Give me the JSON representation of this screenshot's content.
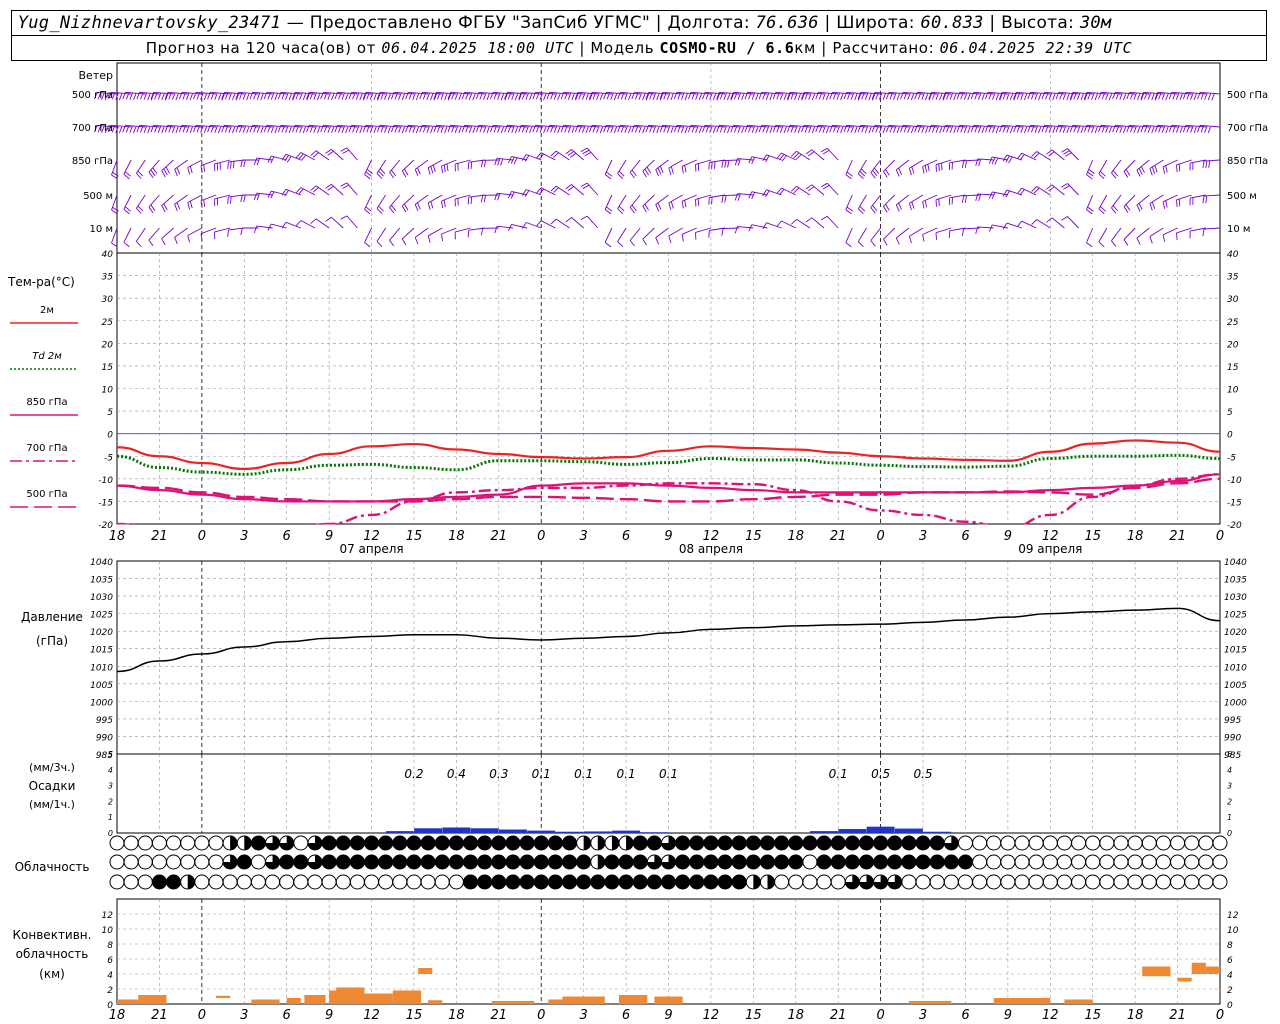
{
  "header": {
    "station": "Yug_Nizhnevartovsky_23471",
    "provider": " — Предоставлено ФГБУ \"ЗапСиб УГМС\" | Долгота: ",
    "lon": "76.636",
    "lat_label": " | Широта: ",
    "lat": "60.833",
    "alt_label": " | Высота: ",
    "alt": "30м",
    "fc_label": "Прогноз на 120 часа(ов) от ",
    "fc_time": "06.04.2025 18:00 UTC",
    "model_label": "  | Модель ",
    "model": "COSMO-RU / 6.6",
    "model_unit": "км",
    "calc_label": " | Рассчитано: ",
    "calc_time": "06.04.2025 22:39 UTC"
  },
  "wind_panel": {
    "title": "Ветер",
    "levels": [
      "500 гПа",
      "700 гПа",
      "850 гПа",
      "500 м",
      "10 м"
    ],
    "color": "#7700cc"
  },
  "temp_panel": {
    "title": "Тем-ра(°С)",
    "legend": [
      {
        "label": "2м",
        "color": "#ee2222",
        "dash": "solid"
      },
      {
        "label": "Td 2м",
        "color": "#007700",
        "dash": "dotted"
      },
      {
        "label": "850 гПа",
        "color": "#dd1177",
        "dash": "solid"
      },
      {
        "label": "700 гПа",
        "color": "#dd1177",
        "dash": "dashdot"
      },
      {
        "label": "500 гПа",
        "color": "#dd1177",
        "dash": "dashed"
      }
    ]
  },
  "pressure_panel": {
    "title": "Давление",
    "unit": "(гПа)"
  },
  "precip_panel": {
    "unit1": "(мм/3ч.)",
    "title": "Осадки",
    "unit2": "(мм/1ч.)",
    "labels": [
      {
        "h": 21,
        "v": "0.2"
      },
      {
        "h": 24,
        "v": "0.4"
      },
      {
        "h": 27,
        "v": "0.3"
      },
      {
        "h": 30,
        "v": "0.1"
      },
      {
        "h": 33,
        "v": "0.1"
      },
      {
        "h": 36,
        "v": "0.1"
      },
      {
        "h": 39,
        "v": "0.1"
      },
      {
        "h": 51,
        "v": "0.1"
      },
      {
        "h": 54,
        "v": "0.5"
      },
      {
        "h": 57,
        "v": "0.5"
      }
    ],
    "color": "#2233cc"
  },
  "cloud_panel": {
    "title": "Облачность"
  },
  "conv_panel": {
    "title1": "Конвективн.",
    "title2": "облачность",
    "unit": "(км)",
    "color": "#ee8833"
  },
  "time_axis": {
    "tick_labels": [
      "18",
      "21",
      "0",
      "3",
      "6",
      "9",
      "12",
      "15",
      "18",
      "21",
      "0",
      "3",
      "6",
      "9",
      "12",
      "15",
      "18",
      "21",
      "0",
      "3",
      "6",
      "9",
      "12",
      "15",
      "18",
      "21",
      "0"
    ],
    "day_labels": [
      {
        "h": 18,
        "label": "07 апреля"
      },
      {
        "h": 42,
        "label": "08 апреля"
      },
      {
        "h": 66,
        "label": "09 апреля"
      }
    ]
  },
  "chart_data": [
    {
      "type": "line",
      "title": "Тем-ра(°С)",
      "ylim": [
        -20,
        40
      ],
      "yticks": [
        40,
        35,
        30,
        25,
        20,
        15,
        10,
        5,
        0,
        -5,
        -10,
        -15,
        -20
      ],
      "x_hours_since_start": [
        0,
        3,
        6,
        9,
        12,
        15,
        18,
        21,
        24,
        27,
        30,
        33,
        36,
        39,
        42,
        45,
        48,
        51,
        54,
        57,
        60,
        63,
        66,
        69,
        72,
        75,
        78
      ],
      "series": [
        {
          "name": "2м",
          "values": [
            -3,
            -5,
            -6.5,
            -7.8,
            -6.5,
            -4.5,
            -2.8,
            -2.3,
            -3.5,
            -4.5,
            -5.2,
            -5.5,
            -5.2,
            -3.8,
            -2.8,
            -3.2,
            -3.5,
            -4.2,
            -5,
            -5.5,
            -5.8,
            -6,
            -4,
            -2.2,
            -1.5,
            -2,
            -4
          ]
        },
        {
          "name": "Td 2м",
          "values": [
            -5,
            -7.5,
            -8.5,
            -9,
            -8,
            -7,
            -6.8,
            -7.5,
            -8,
            -6,
            -6,
            -6.2,
            -6.8,
            -6.4,
            -5.5,
            -5.8,
            -5.8,
            -6.5,
            -7,
            -7.3,
            -7.4,
            -7.2,
            -5.5,
            -5,
            -5,
            -4.8,
            -5.5
          ]
        },
        {
          "name": "850 гПа",
          "values": [
            -11.5,
            -12.5,
            -13.5,
            -14.5,
            -15,
            -15,
            -15,
            -14.5,
            -14,
            -13.5,
            -11.5,
            -11,
            -11,
            -11.5,
            -12,
            -12.5,
            -13,
            -13,
            -13,
            -13,
            -13,
            -13,
            -12.5,
            -12,
            -11.5,
            -10.5,
            -9
          ]
        },
        {
          "name": "700 гПа",
          "values": [
            -20,
            -21,
            -21,
            -21,
            -21,
            -20,
            -18,
            -15,
            -13,
            -12.5,
            -12,
            -12,
            -11.5,
            -11,
            -11,
            -11.2,
            -12.5,
            -15,
            -17,
            -18,
            -19.5,
            -21,
            -18,
            -14,
            -11.5,
            -10,
            -9
          ]
        },
        {
          "name": "500 гПа",
          "values": [
            -11.5,
            -12,
            -13,
            -14,
            -14.5,
            -15,
            -15,
            -15,
            -14.5,
            -14,
            -14,
            -14.2,
            -14.5,
            -15,
            -15,
            -14.5,
            -14,
            -13.5,
            -13.5,
            -13,
            -13,
            -12.8,
            -13,
            -13.5,
            -12,
            -11,
            -10
          ]
        }
      ]
    },
    {
      "type": "line",
      "title": "Давление (гПа)",
      "ylim": [
        985,
        1040
      ],
      "yticks": [
        1040,
        1035,
        1030,
        1025,
        1020,
        1015,
        1010,
        1005,
        1000,
        995,
        990,
        985
      ],
      "x_hours_since_start": [
        0,
        3,
        6,
        9,
        12,
        15,
        18,
        21,
        24,
        27,
        30,
        33,
        36,
        39,
        42,
        45,
        48,
        51,
        54,
        57,
        60,
        63,
        66,
        69,
        72,
        75,
        78
      ],
      "series": [
        {
          "name": "Давление",
          "values": [
            1008.5,
            1011.5,
            1013.5,
            1015.5,
            1017,
            1018,
            1018.5,
            1019,
            1019,
            1018,
            1017.5,
            1018,
            1018.5,
            1019.5,
            1020.5,
            1021,
            1021.5,
            1021.8,
            1022,
            1022.5,
            1023.2,
            1024,
            1025,
            1025.5,
            1026,
            1026.5,
            1023
          ]
        }
      ]
    },
    {
      "type": "bar",
      "title": "Осадки (мм/1ч.)",
      "ylim": [
        0,
        5
      ],
      "x_hours_since_start": [
        20,
        22,
        24,
        26,
        28,
        30,
        32,
        34,
        36,
        38,
        50,
        52,
        54,
        56,
        58
      ],
      "values": [
        0.12,
        0.3,
        0.35,
        0.3,
        0.22,
        0.15,
        0.08,
        0.1,
        0.15,
        0.05,
        0.12,
        0.25,
        0.4,
        0.28,
        0.08
      ]
    },
    {
      "type": "bar",
      "title": "Конвективн. облачность (км)",
      "ylim": [
        0,
        14
      ],
      "yticks": [
        12,
        10,
        8,
        6,
        4,
        2,
        0
      ],
      "segments": [
        {
          "h": 0.5,
          "w": 2,
          "bottom": 0,
          "top": 0.6
        },
        {
          "h": 2.5,
          "w": 2,
          "bottom": 0,
          "top": 1.2
        },
        {
          "h": 7.5,
          "w": 1,
          "bottom": 0.8,
          "top": 1.1
        },
        {
          "h": 10.5,
          "w": 2,
          "bottom": 0,
          "top": 0.6
        },
        {
          "h": 12.5,
          "w": 1,
          "bottom": 0,
          "top": 0.8
        },
        {
          "h": 14,
          "w": 1.5,
          "bottom": 0,
          "top": 1.2
        },
        {
          "h": 15.5,
          "w": 1,
          "bottom": 0,
          "top": 1.8
        },
        {
          "h": 16.5,
          "w": 2,
          "bottom": 0,
          "top": 2.2
        },
        {
          "h": 18.5,
          "w": 2,
          "bottom": 0,
          "top": 1.4
        },
        {
          "h": 20.5,
          "w": 2,
          "bottom": 0,
          "top": 1.8
        },
        {
          "h": 21.8,
          "w": 1,
          "bottom": 4,
          "top": 4.8
        },
        {
          "h": 22.5,
          "w": 1,
          "bottom": 0,
          "top": 0.5
        },
        {
          "h": 28,
          "w": 3,
          "bottom": 0,
          "top": 0.4
        },
        {
          "h": 31.5,
          "w": 2,
          "bottom": 0,
          "top": 0.6
        },
        {
          "h": 33,
          "w": 3,
          "bottom": 0,
          "top": 1.0
        },
        {
          "h": 36.5,
          "w": 2,
          "bottom": 0,
          "top": 1.2
        },
        {
          "h": 39,
          "w": 2,
          "bottom": 0,
          "top": 1.0
        },
        {
          "h": 57.5,
          "w": 3,
          "bottom": 0,
          "top": 0.4
        },
        {
          "h": 64,
          "w": 4,
          "bottom": 0,
          "top": 0.8
        },
        {
          "h": 68,
          "w": 2,
          "bottom": 0,
          "top": 0.6
        },
        {
          "h": 73.5,
          "w": 2,
          "bottom": 3.7,
          "top": 5
        },
        {
          "h": 75.5,
          "w": 1,
          "bottom": 3,
          "top": 3.5
        },
        {
          "h": 76.5,
          "w": 1,
          "bottom": 4,
          "top": 5.5
        },
        {
          "h": 77.5,
          "w": 1,
          "bottom": 4,
          "top": 5
        },
        {
          "h": 78.5,
          "w": 1,
          "bottom": 1.5,
          "top": 2
        }
      ]
    }
  ]
}
